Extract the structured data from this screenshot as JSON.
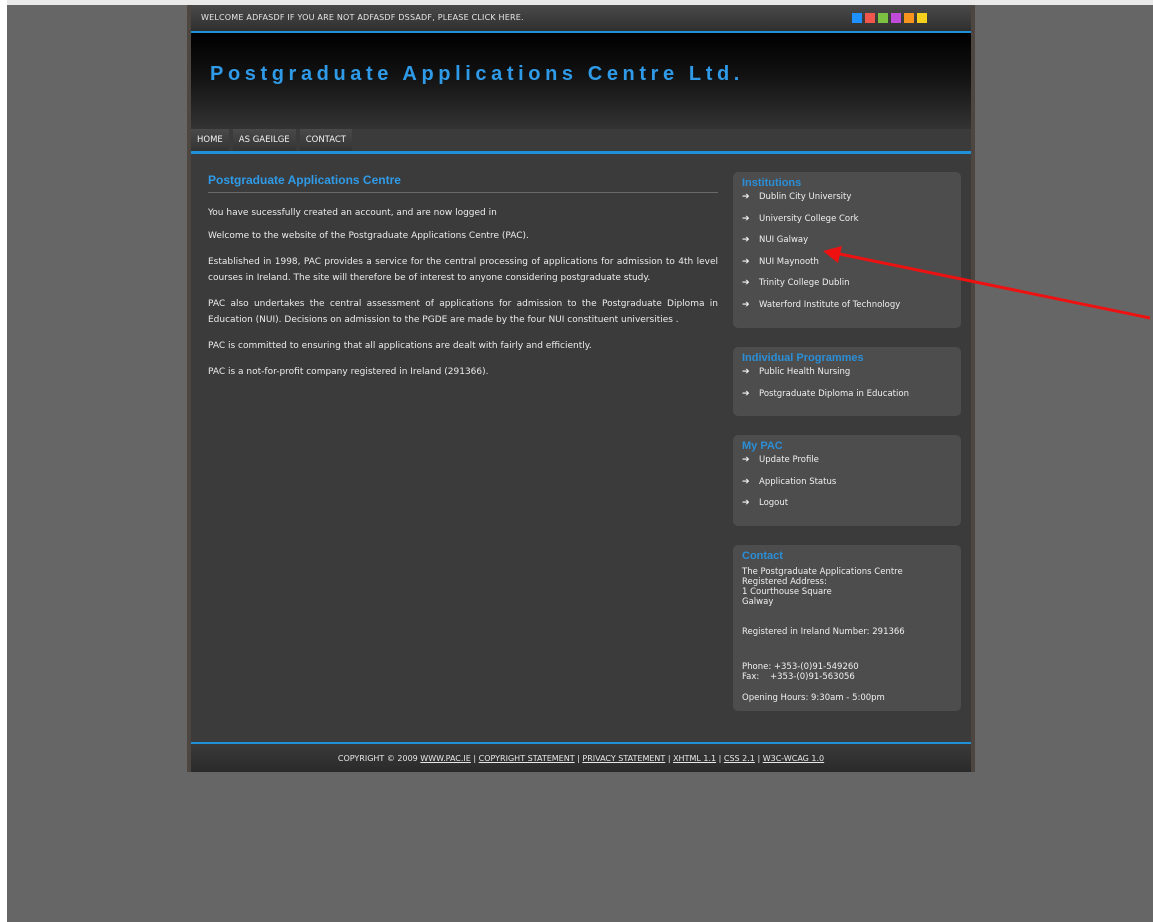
{
  "welcome_bar": {
    "text": "WELCOME ADFASDF IF YOU ARE NOT ADFASDF DSSADF, PLEASE CLICK HERE.",
    "swatches": [
      "#1e90ff",
      "#f0564b",
      "#7cc142",
      "#c04bd8",
      "#f7941d",
      "#f4d01d"
    ]
  },
  "header": {
    "title": "Postgraduate Applications Centre Ltd."
  },
  "nav": {
    "items": [
      "HOME",
      "AS GAEILGE",
      "CONTACT"
    ]
  },
  "main": {
    "title": "Postgraduate Applications Centre",
    "paragraphs": [
      "You have sucessfully created an account, and are now logged in",
      "Welcome to the website of the Postgraduate Applications Centre (PAC).",
      "Established in 1998, PAC provides a service for the central processing of applications for admission to 4th level courses in Ireland. The site will therefore be of interest to anyone considering postgraduate study.",
      "PAC also undertakes the central assessment of applications for admission to the Postgraduate Diploma in Education (NUI). Decisions on admission to the PGDE are made by the four NUI constituent universities .",
      "PAC is committed to ensuring that all applications are dealt with fairly and efficiently.",
      "PAC is a not-for-profit company registered in Ireland (291366)."
    ]
  },
  "sidebar": {
    "institutions": {
      "title": "Institutions",
      "items": [
        "Dublin City University",
        "University College Cork",
        "NUI Galway",
        "NUI Maynooth",
        "Trinity College Dublin",
        "Waterford Institute of Technology"
      ]
    },
    "programmes": {
      "title": "Individual Programmes",
      "items": [
        "Public Health Nursing",
        "Postgraduate Diploma in Education"
      ]
    },
    "mypac": {
      "title": "My PAC",
      "items": [
        "Update Profile",
        "Application Status",
        "Logout"
      ]
    },
    "contact": {
      "title": "Contact",
      "address": "The Postgraduate Applications Centre\nRegistered Address:\n1 Courthouse Square\nGalway",
      "registered": "Registered in Ireland Number: 291366",
      "phone": "Phone: +353-(0)91-549260",
      "fax": "Fax:    +353-(0)91-563056",
      "hours": "Opening Hours: 9:30am - 5:00pm"
    }
  },
  "footer": {
    "prefix": "COPYRIGHT © 2009",
    "links": [
      "WWW.PAC.IE",
      "COPYRIGHT STATEMENT",
      "PRIVACY STATEMENT",
      "XHTML 1.1",
      "CSS 2.1",
      "W3C-WCAG 1.0"
    ],
    "separator": "|"
  },
  "annotation": {
    "arrow_color": "#ee1111"
  }
}
